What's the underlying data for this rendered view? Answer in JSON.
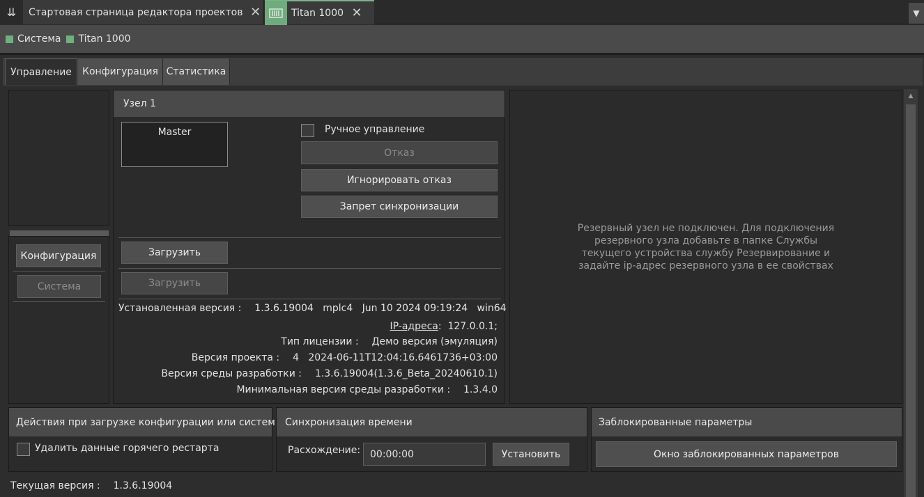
{
  "tabs": {
    "start_label": "Стартовая страница редактора проектов",
    "titan_label": "Titan 1000"
  },
  "breadcrumb": {
    "items": [
      "Система",
      "Titan 1000"
    ]
  },
  "page_tabs": [
    "Управление",
    "Конфигурация",
    "Статистика"
  ],
  "left_panel": {
    "config_button": "Конфигурация",
    "system_button": "Система"
  },
  "node": {
    "title": "Узел 1",
    "role": "Master",
    "manual_control_label": "Ручное управление",
    "fault_button": "Отказ",
    "ignore_fault_button": "Игнорировать отказ",
    "sync_ban_button": "Запрет синхронизации",
    "load_button_1": "Загрузить",
    "load_button_2": "Загрузить",
    "installed_version_label": "Установленная версия :",
    "installed_version_value": "1.3.6.19004   mplc4   Jun 10 2024 09:19:24   win64",
    "ip_label": "IP-адреса",
    "ip_value": ":  127.0.0.1;",
    "license_label": "Тип лицензии :",
    "license_value": "Демо версия (эмуляция)",
    "project_version_label": "Версия проекта :",
    "project_version_value": "4   2024-06-11T12:04:16.6461736+03:00",
    "ide_version_label": "Версия среды разработки :",
    "ide_version_value": "1.3.6.19004(1.3.6_Beta_20240610.1)",
    "min_ide_version_label": "Минимальная версия среды разработки :",
    "min_ide_version_value": "1.3.4.0"
  },
  "reserve_message": "Резервный узел не подключен. Для подключения резервного узла добавьте в папке Службы текущего устройства службу Резервирование и задайте ip-адрес резервного узла в ее свойствах",
  "actions_panel": {
    "title": "Действия при загрузке конфигурации или системы",
    "delete_hot_restart_label": "Удалить данные горячего рестарта"
  },
  "time_sync": {
    "title": "Синхронизация времени",
    "drift_label": "Расхождение:",
    "drift_value": "00:00:00",
    "set_button": "Установить"
  },
  "locked_params": {
    "title": "Заблокированные параметры",
    "window_button": "Окно заблокированных параметров"
  },
  "current_version_label": "Текущая версия :",
  "current_version_value": "1.3.6.19004",
  "colors": {
    "accent_green": "#6fb07c",
    "background": "#2d2d2d",
    "header": "#4a4a4a"
  }
}
